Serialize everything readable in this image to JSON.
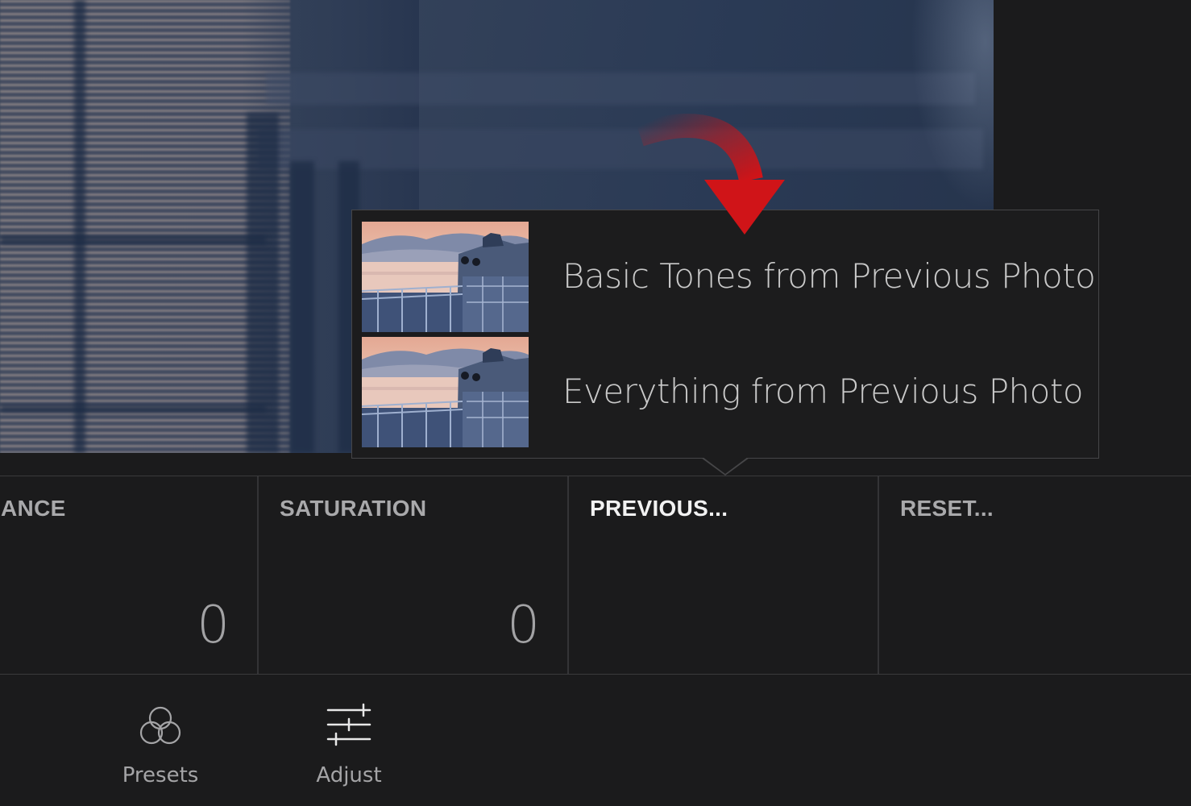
{
  "popup": {
    "items": [
      {
        "label": "Basic Tones from Previous Photo"
      },
      {
        "label": "Everything from Previous Photo"
      }
    ]
  },
  "tools": [
    {
      "label": "BRANCE",
      "value": "0",
      "active": false
    },
    {
      "label": "SATURATION",
      "value": "0",
      "active": false
    },
    {
      "label": "PREVIOUS...",
      "value": "",
      "active": true
    },
    {
      "label": "RESET...",
      "value": "",
      "active": false
    }
  ],
  "nav": {
    "presets": {
      "label": "Presets",
      "icon": "presets-icon"
    },
    "adjust": {
      "label": "Adjust",
      "icon": "sliders-icon"
    }
  },
  "colors": {
    "background": "#1b1b1c",
    "accent_arrow": "#d01418",
    "active_label": "#f2f2f2",
    "inactive_label": "#a9a9ab"
  }
}
